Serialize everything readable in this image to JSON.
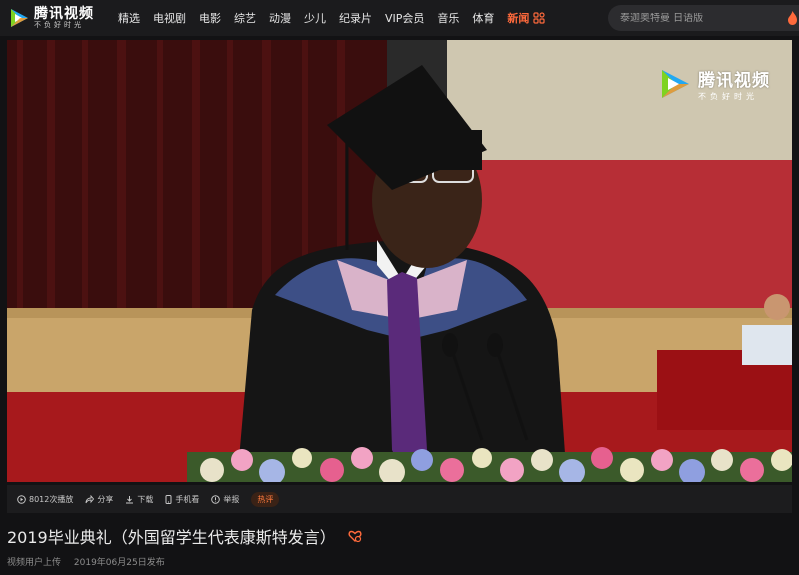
{
  "header": {
    "logo_title": "腾讯视频",
    "logo_sub": "不负好时光",
    "nav": [
      "精选",
      "电视剧",
      "电影",
      "综艺",
      "动漫",
      "少儿",
      "纪录片",
      "VIP会员",
      "音乐",
      "体育"
    ],
    "nav_hot": "新闻",
    "search_placeholder": "泰迦奥特曼 日语版"
  },
  "player": {
    "watermark_title": "腾讯视频",
    "watermark_sub": "不负好时光"
  },
  "actions": {
    "plays": "8012次播放",
    "share": "分享",
    "download": "下载",
    "mobile": "手机看",
    "report": "举报",
    "hot": "热评"
  },
  "video": {
    "title": "2019毕业典礼（外国留学生代表康斯特发言）",
    "uploader": "视频用户上传",
    "date": "2019年06月25日发布"
  },
  "colors": {
    "accent": "#ff6a3c",
    "background": "#121214",
    "logo_blue": "#23a8f2",
    "logo_green": "#7ed321",
    "logo_orange": "#ff9a1f"
  }
}
